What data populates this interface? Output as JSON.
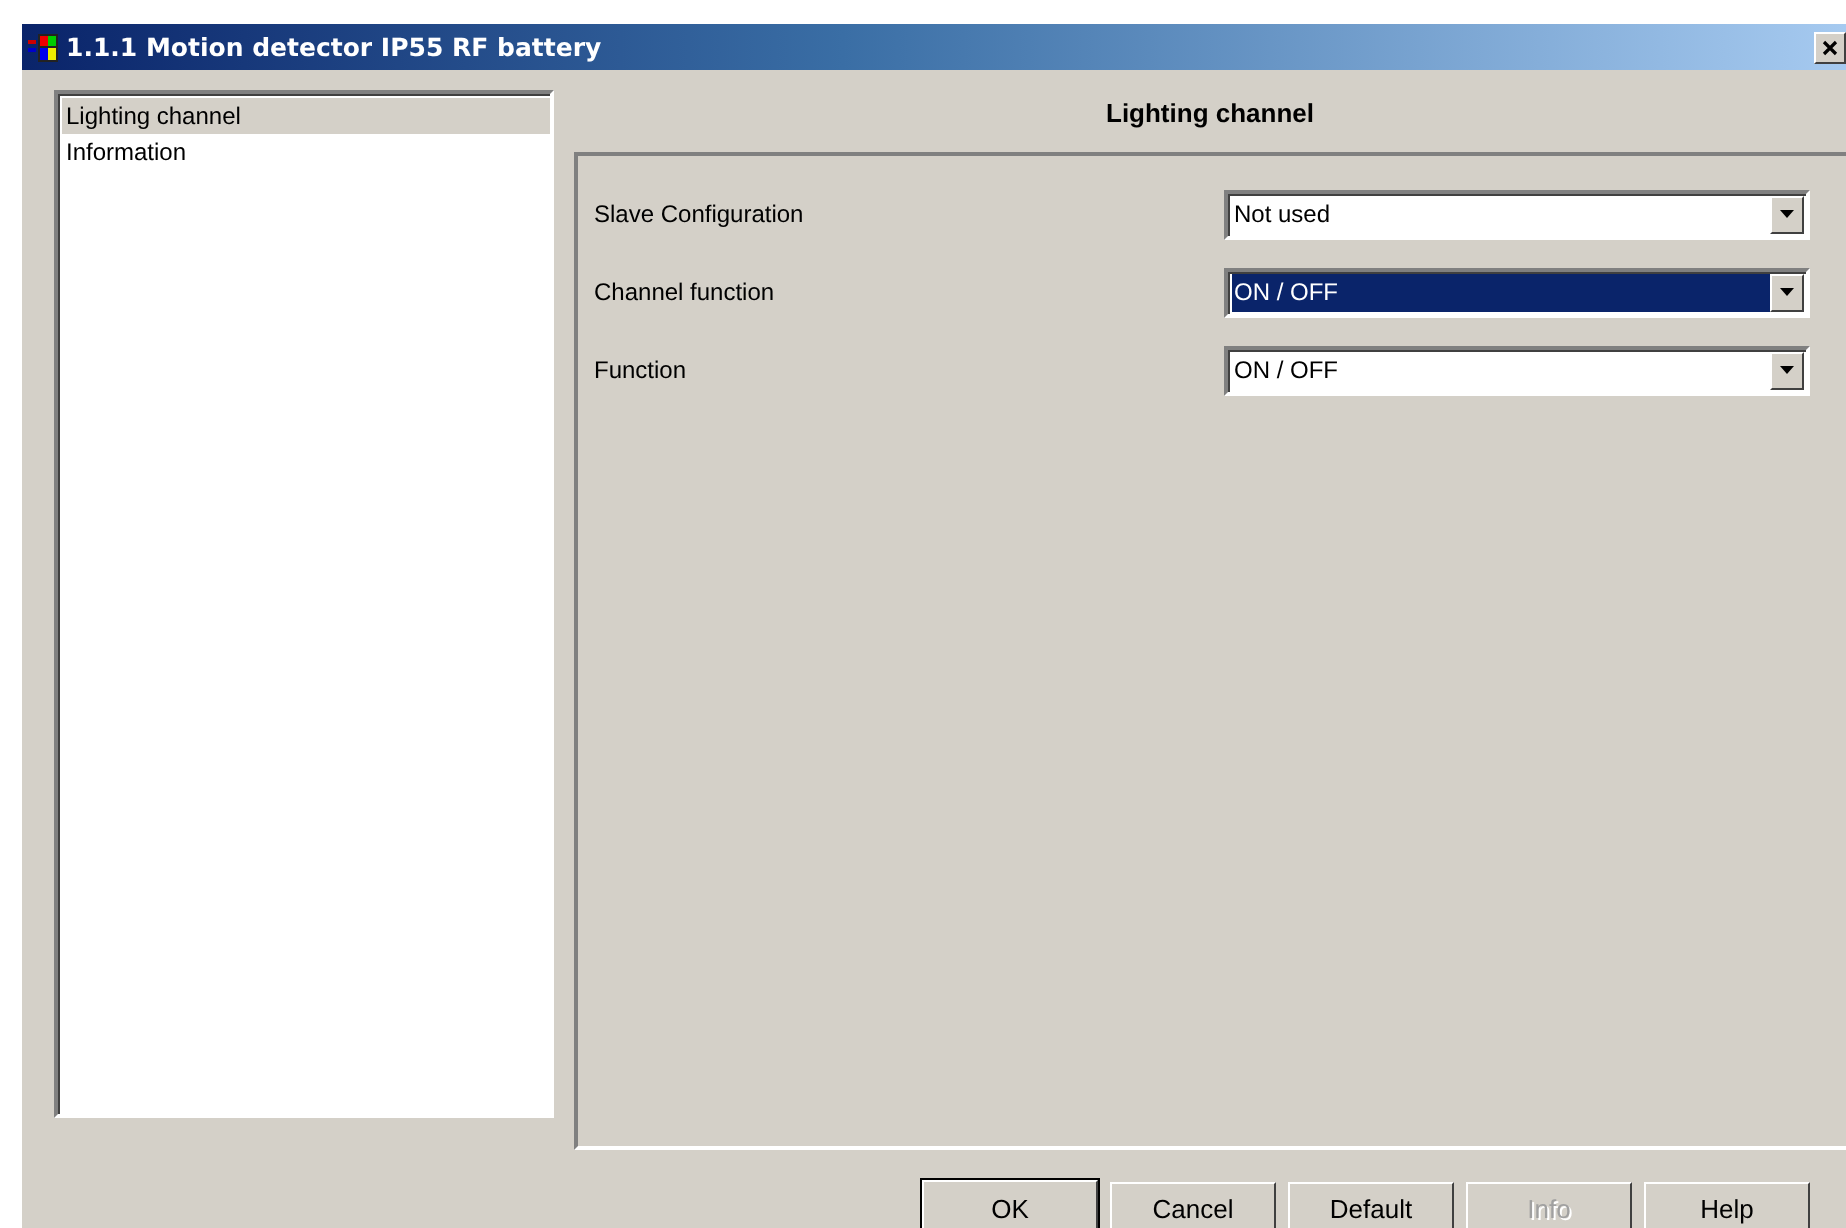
{
  "window": {
    "title": "1.1.1 Motion detector IP55 RF battery"
  },
  "sidebar": {
    "items": [
      {
        "label": "Lighting channel",
        "selected": true
      },
      {
        "label": "Information",
        "selected": false
      }
    ]
  },
  "panel": {
    "heading": "Lighting channel",
    "fields": [
      {
        "label": "Slave Configuration",
        "value": "Not used",
        "highlighted": false
      },
      {
        "label": "Channel function",
        "value": "ON / OFF",
        "highlighted": true
      },
      {
        "label": "Function",
        "value": "ON / OFF",
        "highlighted": false
      }
    ]
  },
  "buttons": [
    {
      "label": "OK",
      "disabled": false,
      "default": true
    },
    {
      "label": "Cancel",
      "disabled": false,
      "default": false
    },
    {
      "label": "Default",
      "disabled": false,
      "default": false
    },
    {
      "label": "Info",
      "disabled": true,
      "default": false
    },
    {
      "label": "Help",
      "disabled": false,
      "default": false
    }
  ]
}
